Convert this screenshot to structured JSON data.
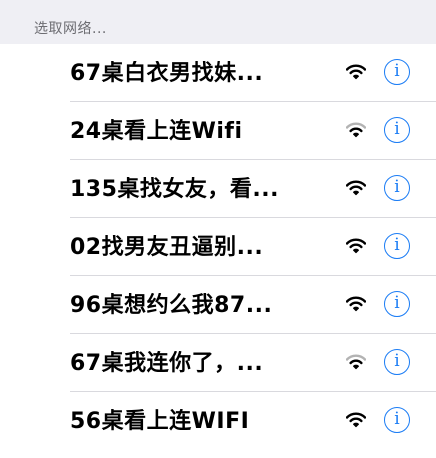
{
  "section": {
    "header": "选取网络..."
  },
  "networks": [
    {
      "name": "67桌白衣男找妹...",
      "signal_bars": 3,
      "info_label": "i"
    },
    {
      "name": "24桌看上连Wifi",
      "signal_bars": 2,
      "info_label": "i"
    },
    {
      "name": "135桌找女友，看...",
      "signal_bars": 3,
      "info_label": "i"
    },
    {
      "name": "02找男友丑逼别...",
      "signal_bars": 3,
      "info_label": "i"
    },
    {
      "name": "96桌想约么我87...",
      "signal_bars": 3,
      "info_label": "i"
    },
    {
      "name": "67桌我连你了，...",
      "signal_bars": 2,
      "info_label": "i"
    },
    {
      "name": "56桌看上连WIFI",
      "signal_bars": 3,
      "info_label": "i"
    }
  ],
  "colors": {
    "accent": "#1a7cf5",
    "signal_active": "#000000",
    "signal_dim": "#b3b3b3",
    "section_bg": "#efeff4"
  },
  "icons": {
    "wifi": "wifi-signal-icon",
    "info": "info-icon"
  }
}
